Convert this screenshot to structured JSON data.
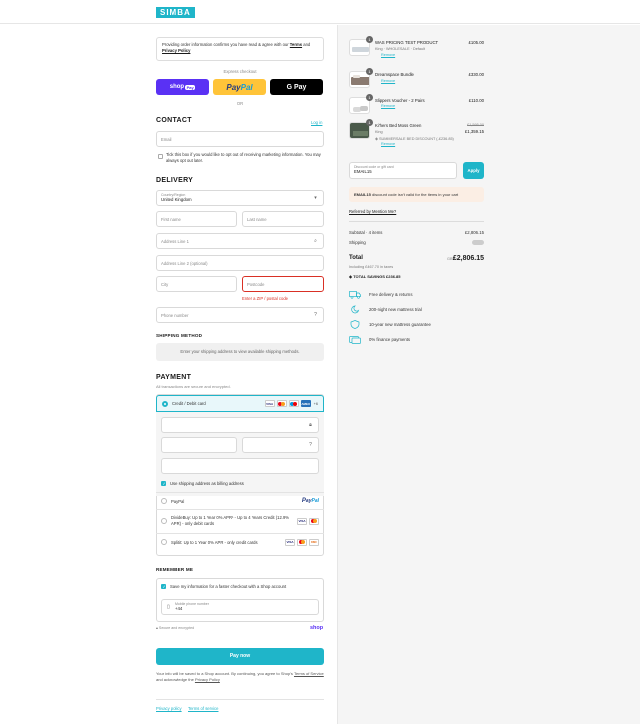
{
  "brand": {
    "logo_text": "SIMBA",
    "accent": "#1fb5c9"
  },
  "notice": {
    "text": "Providing order information confirms you have read & agree with our",
    "terms_link": "Terms",
    "and": "and",
    "privacy_link": "Privacy Policy"
  },
  "express": {
    "label": "Express checkout",
    "shop_pay": "shop",
    "shop_pay_tag": "Pay",
    "paypal_a": "Pay",
    "paypal_b": "Pal",
    "gpay": "G Pay",
    "or": "OR"
  },
  "contact": {
    "title": "CONTACT",
    "login": "Log in",
    "email_placeholder": "Email",
    "optout": "Tick this box if you would like to opt out of receiving marketing information. You may always opt out later."
  },
  "delivery": {
    "title": "DELIVERY",
    "country_label": "Country/Region",
    "country_value": "United Kingdom",
    "first_name": "First name",
    "last_name": "Last name",
    "address1": "Address Line 1",
    "address2": "Address Line 2 (optional)",
    "city": "City",
    "postcode": "Postcode",
    "postcode_error": "Enter a ZIP / postal code",
    "phone": "Phone number"
  },
  "shipping": {
    "title": "SHIPPING METHOD",
    "placeholder": "Enter your shipping address to view available shipping methods."
  },
  "payment": {
    "title": "PAYMENT",
    "subtitle": "All transactions are secure and encrypted.",
    "card_label": "Credit / Debit card",
    "more": "+6",
    "billing_same": "Use shipping address as billing address",
    "paypal_label": "PayPal",
    "divide_label": "DivideBuy: Up to 1 Year 0% APR¹ - Up to 4 Years Credit (12.9% APR) - only debit cards",
    "splitit_label": "Splitit: Up to 1 Year 0% APR - only credit cards"
  },
  "remember": {
    "title": "REMEMBER ME",
    "save_label": "Save my information for a faster checkout with a Shop account",
    "mobile_label": "Mobile phone number",
    "mobile_value": "+44",
    "secure": "Secure and encrypted",
    "shop": "shop"
  },
  "paynow": {
    "label": "Pay now"
  },
  "footer": {
    "info": "Your info will be saved to a Shop account. By continuing, you agree to Shop's",
    "terms": "Terms of Service",
    "and": "and acknowledge the",
    "privacy": "Privacy Policy",
    "privacy_policy": "Privacy policy",
    "terms_of_service": "Terms of service"
  },
  "cart": {
    "items": [
      {
        "qty": "1",
        "name": "WAS PRICING TEST PRODUCT",
        "variant": "King · WHOLESALE · Default",
        "price": "£105.00",
        "remove": "Remove"
      },
      {
        "qty": "1",
        "name": "Dreamspace Bundle",
        "variant": "",
        "price": "£330.00",
        "remove": "Remove"
      },
      {
        "qty": "1",
        "name": "Slippers Voucher - 2 Pairs",
        "variant": "",
        "price": "£110.00",
        "remove": "Remove"
      },
      {
        "qty": "1",
        "name": "Ki'hers Bed Moss Green",
        "variant": "King",
        "discount": "SUMMERSALE BED DISCOUNT (-£236.85)",
        "old_price": "£1,595.00",
        "price": "£1,359.15",
        "remove": "Remove"
      }
    ],
    "discount_label": "Discount code or gift card",
    "discount_value": "EMAIL15",
    "apply": "Apply",
    "discount_error_code": "EMAIL15",
    "discount_error": "discount code isn't valid for the items in your cart",
    "referred": "Referred by Mention Me?",
    "subtotal_label": "Subtotal · 4 items",
    "subtotal_value": "£2,806.15",
    "shipping_label": "Shipping",
    "total_label": "Total",
    "currency": "GBP",
    "total_value": "£2,806.15",
    "tax_note": "Including £467.70 in taxes",
    "savings_label": "TOTAL SAVINGS",
    "savings_value": "£236.85"
  },
  "features": [
    {
      "icon": "truck-icon",
      "text": "Free delivery & returns"
    },
    {
      "icon": "moon-icon",
      "text": "200-night new mattress trial"
    },
    {
      "icon": "shield-icon",
      "text": "10-year new mattress guarantee"
    },
    {
      "icon": "card-icon",
      "text": "0% finance payments"
    }
  ]
}
